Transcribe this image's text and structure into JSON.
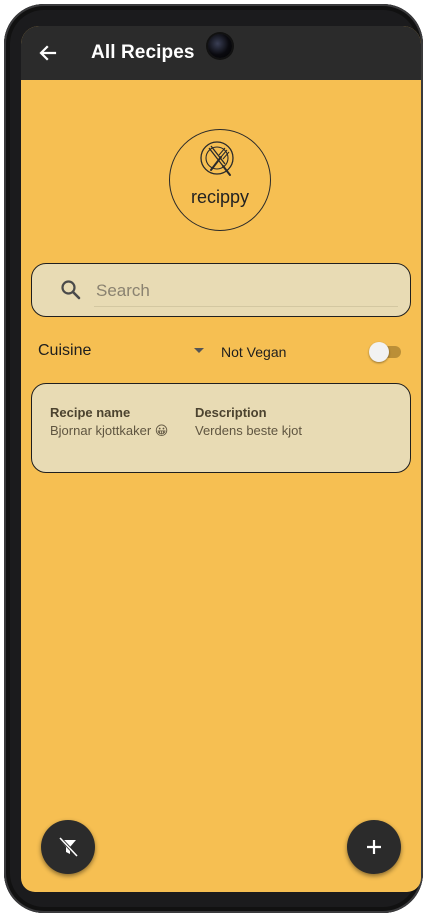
{
  "appbar": {
    "title": "All Recipes",
    "back_icon": "arrow-left-icon"
  },
  "logo": {
    "text": "recippy",
    "icon": "plate-fork-knife-icon"
  },
  "search": {
    "placeholder": "Search",
    "value": "",
    "icon": "search-icon"
  },
  "filters": {
    "cuisine_label": "Cuisine",
    "vegan_label": "Not Vegan",
    "vegan_toggle_on": false
  },
  "recipes": [
    {
      "name_header": "Recipe name",
      "name": "Bjornar kjottkaker 😀",
      "description_header": "Description",
      "description": "Verdens beste kjot"
    }
  ],
  "fabs": {
    "left_icon": "filter-off-icon",
    "right_icon": "plus-icon"
  },
  "colors": {
    "background": "#f6bf52",
    "appbar": "#2b2b2b",
    "card": "#e8dbb4"
  }
}
